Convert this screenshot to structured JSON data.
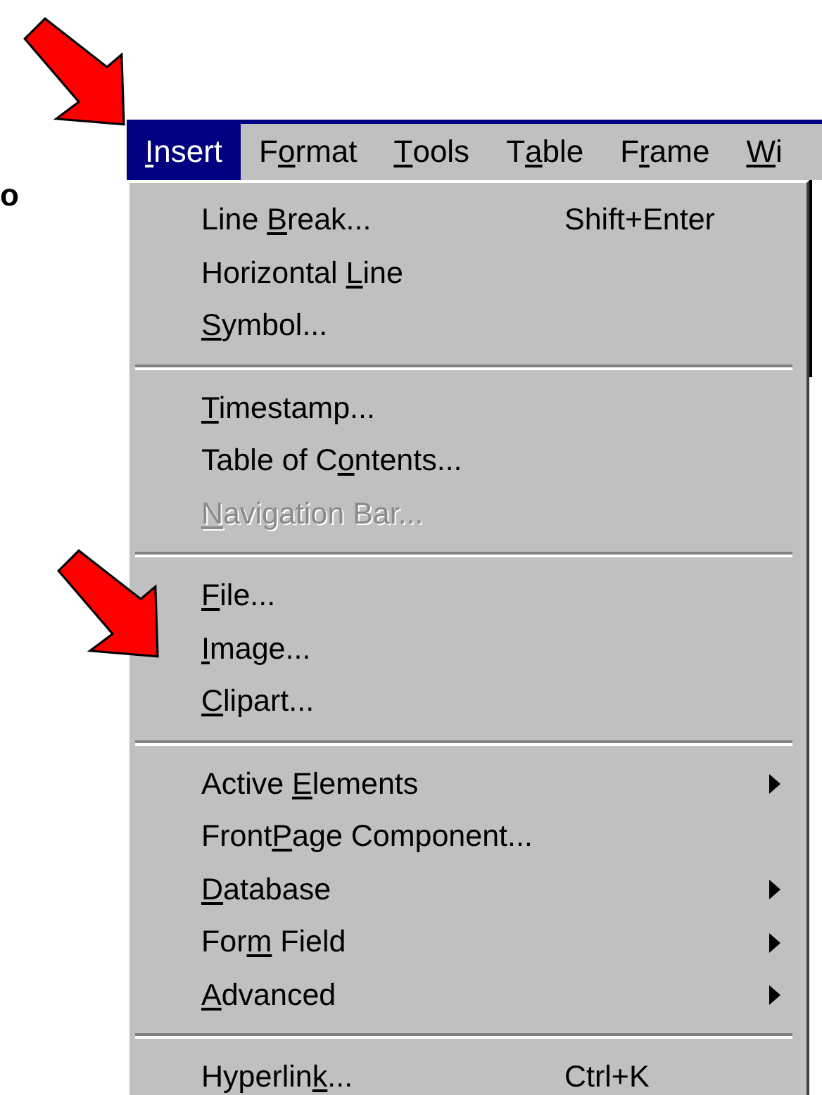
{
  "side_text": "o",
  "menu_bar": [
    {
      "parts": {
        "key": "I",
        "after": "nsert"
      },
      "selected": true
    },
    {
      "parts": {
        "before": "F",
        "key": "o",
        "after": "rmat"
      },
      "selected": false
    },
    {
      "parts": {
        "key": "T",
        "after": "ools"
      },
      "selected": false
    },
    {
      "parts": {
        "before": "T",
        "key": "a",
        "after": "ble"
      },
      "selected": false
    },
    {
      "parts": {
        "before": "F",
        "key": "r",
        "after": "ame"
      },
      "selected": false
    },
    {
      "parts": {
        "key": "W",
        "after": "i"
      },
      "selected": false
    }
  ],
  "menu": [
    {
      "kind": "item",
      "parts": {
        "before": "Line ",
        "key": "B",
        "after": "reak..."
      },
      "shortcut": "Shift+Enter",
      "disabled": false,
      "submenu": false
    },
    {
      "kind": "item",
      "parts": {
        "before": "Horizontal ",
        "key": "L",
        "after": "ine"
      },
      "disabled": false,
      "submenu": false
    },
    {
      "kind": "item",
      "parts": {
        "key": "S",
        "after": "ymbol..."
      },
      "disabled": false,
      "submenu": false
    },
    {
      "kind": "separator"
    },
    {
      "kind": "item",
      "parts": {
        "key": "T",
        "after": "imestamp..."
      },
      "disabled": false,
      "submenu": false
    },
    {
      "kind": "item",
      "parts": {
        "before": "Table of C",
        "key": "o",
        "after": "ntents..."
      },
      "disabled": false,
      "submenu": false
    },
    {
      "kind": "item",
      "parts": {
        "key": "N",
        "after": "avigation Bar..."
      },
      "disabled": true,
      "submenu": false
    },
    {
      "kind": "separator"
    },
    {
      "kind": "item",
      "parts": {
        "key": "F",
        "after": "ile..."
      },
      "disabled": false,
      "submenu": false
    },
    {
      "kind": "item",
      "parts": {
        "key": "I",
        "after": "mage..."
      },
      "disabled": false,
      "submenu": false
    },
    {
      "kind": "item",
      "parts": {
        "key": "C",
        "after": "lipart..."
      },
      "disabled": false,
      "submenu": false
    },
    {
      "kind": "separator"
    },
    {
      "kind": "item",
      "parts": {
        "before": "Active ",
        "key": "E",
        "after": "lements"
      },
      "disabled": false,
      "submenu": true
    },
    {
      "kind": "item",
      "parts": {
        "before": "Front",
        "key": "P",
        "after": "age Component..."
      },
      "disabled": false,
      "submenu": false
    },
    {
      "kind": "item",
      "parts": {
        "key": "D",
        "after": "atabase"
      },
      "disabled": false,
      "submenu": true
    },
    {
      "kind": "item",
      "parts": {
        "before": "For",
        "key": "m",
        "after": " Field"
      },
      "disabled": false,
      "submenu": true
    },
    {
      "kind": "item",
      "parts": {
        "key": "A",
        "after": "dvanced"
      },
      "disabled": false,
      "submenu": true
    },
    {
      "kind": "separator"
    },
    {
      "kind": "item",
      "parts": {
        "before": "Hyperlin",
        "key": "k",
        "after": "..."
      },
      "shortcut": "Ctrl+K",
      "disabled": false,
      "submenu": false
    }
  ]
}
